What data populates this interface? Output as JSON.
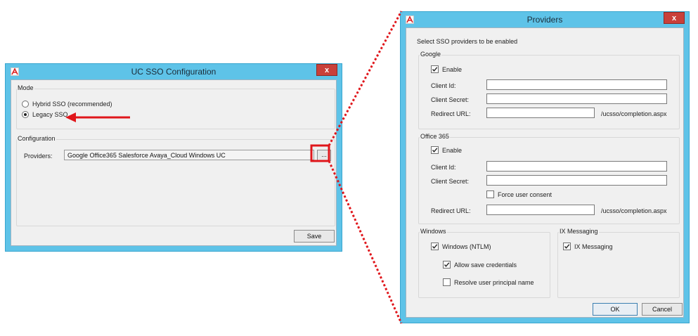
{
  "sso_window": {
    "title": "UC SSO Configuration",
    "close_label": "x",
    "mode_group": "Mode",
    "hybrid_label": "Hybrid SSO (recommended)",
    "legacy_label": "Legacy SSO",
    "selected_mode": "Legacy SSO",
    "config_group": "Configuration",
    "providers_label": "Providers:",
    "providers_value": "Google Office365 Salesforce Avaya_Cloud Windows UC",
    "browse_label": "...",
    "save_label": "Save"
  },
  "providers_window": {
    "title": "Providers",
    "close_label": "x",
    "intro": "Select SSO providers to be enabled",
    "google": {
      "group": "Google",
      "enable_label": "Enable",
      "enable_checked": true,
      "client_id_label": "Client Id:",
      "client_id_value": "",
      "client_secret_label": "Client Secret:",
      "client_secret_value": "",
      "redirect_label": "Redirect URL:",
      "redirect_value": "",
      "redirect_suffix": "/ucsso/completion.aspx"
    },
    "office365": {
      "group": "Office 365",
      "enable_label": "Enable",
      "enable_checked": true,
      "client_id_label": "Client Id:",
      "client_id_value": "",
      "client_secret_label": "Client Secret:",
      "client_secret_value": "",
      "force_consent_label": "Force user consent",
      "force_consent_checked": false,
      "redirect_label": "Redirect URL:",
      "redirect_value": "",
      "redirect_suffix": "/ucsso/completion.aspx"
    },
    "windows": {
      "group": "Windows",
      "ntlm_label": "Windows (NTLM)",
      "ntlm_checked": true,
      "allow_save_label": "Allow save credentials",
      "allow_save_checked": true,
      "resolve_upn_label": "Resolve user principal name",
      "resolve_upn_checked": false
    },
    "ix": {
      "group": "IX Messaging",
      "ix_label": "IX Messaging",
      "ix_checked": true
    },
    "ok_label": "OK",
    "cancel_label": "Cancel"
  },
  "colors": {
    "window_frame": "#5ec3e8",
    "close_button": "#c9403a",
    "annotation": "#e0161b"
  }
}
